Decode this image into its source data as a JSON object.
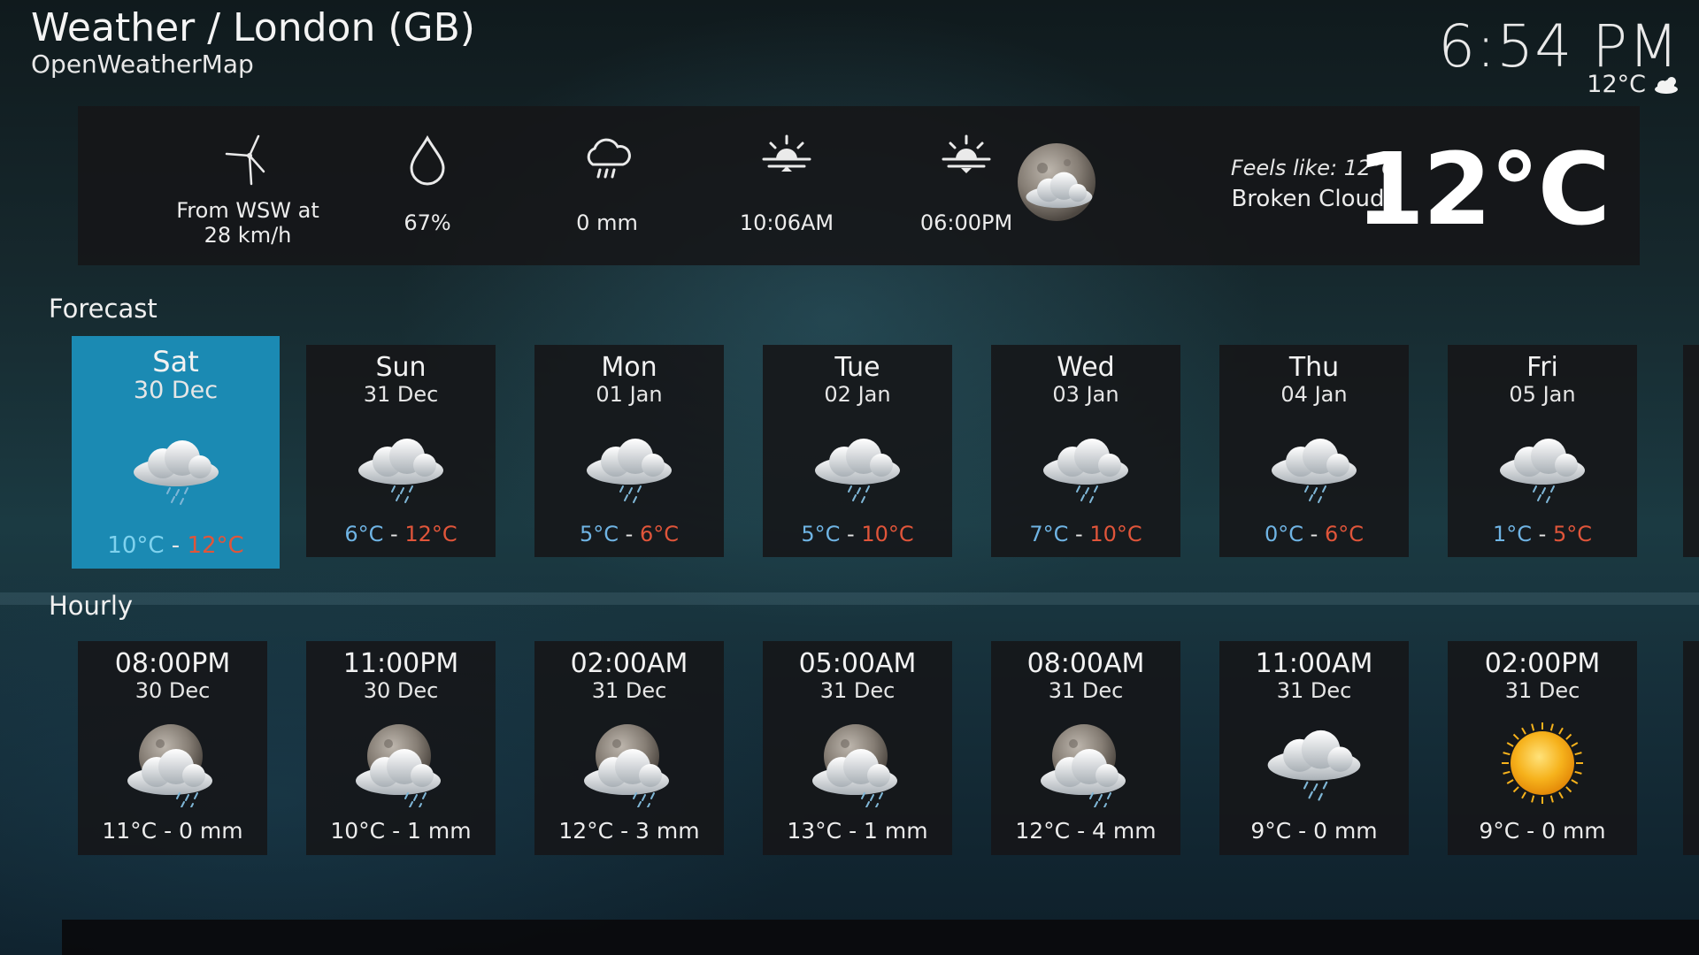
{
  "header": {
    "title": "Weather / London (GB)",
    "provider": "OpenWeatherMap",
    "clock": "6:54 PM",
    "clock_temp": "12°C",
    "clock_icon": "cloud-icon"
  },
  "current": {
    "wind": "From WSW at\n28 km/h",
    "wind_icon": "wind-turbine-icon",
    "humidity": "67%",
    "humidity_icon": "droplet-icon",
    "precipitation": "0 mm",
    "precipitation_icon": "rain-cloud-icon",
    "sunrise": "10:06AM",
    "sunrise_icon": "sunrise-icon",
    "sunset": "06:00PM",
    "sunset_icon": "sunset-icon",
    "condition_icon": "moon-cloud-icon",
    "feels_like": "Feels like: 12°C",
    "condition": "Broken Clouds",
    "temperature": "12°C"
  },
  "sections": {
    "forecast": "Forecast",
    "hourly": "Hourly"
  },
  "forecast": [
    {
      "day": "Sat",
      "date": "30 Dec",
      "low": "10°C",
      "sep": " - ",
      "high": "12°C",
      "icon": "rain-cloud-icon"
    },
    {
      "day": "Sun",
      "date": "31 Dec",
      "low": "6°C",
      "sep": " - ",
      "high": "12°C",
      "icon": "rain-cloud-icon"
    },
    {
      "day": "Mon",
      "date": "01 Jan",
      "low": "5°C",
      "sep": " - ",
      "high": "6°C",
      "icon": "rain-cloud-icon"
    },
    {
      "day": "Tue",
      "date": "02 Jan",
      "low": "5°C",
      "sep": " - ",
      "high": "10°C",
      "icon": "rain-cloud-icon"
    },
    {
      "day": "Wed",
      "date": "03 Jan",
      "low": "7°C",
      "sep": " - ",
      "high": "10°C",
      "icon": "rain-cloud-icon"
    },
    {
      "day": "Thu",
      "date": "04 Jan",
      "low": "0°C",
      "sep": " - ",
      "high": "6°C",
      "icon": "rain-cloud-icon"
    },
    {
      "day": "Fri",
      "date": "05 Jan",
      "low": "1°C",
      "sep": " - ",
      "high": "5°C",
      "icon": "rain-cloud-icon"
    }
  ],
  "hourly": [
    {
      "time": "08:00PM",
      "date": "30 Dec",
      "value": "11°C - 0 mm",
      "icon": "moon-rain-icon"
    },
    {
      "time": "11:00PM",
      "date": "30 Dec",
      "value": "10°C - 1 mm",
      "icon": "moon-rain-icon"
    },
    {
      "time": "02:00AM",
      "date": "31 Dec",
      "value": "12°C - 3 mm",
      "icon": "moon-rain-icon"
    },
    {
      "time": "05:00AM",
      "date": "31 Dec",
      "value": "13°C - 1 mm",
      "icon": "moon-rain-icon"
    },
    {
      "time": "08:00AM",
      "date": "31 Dec",
      "value": "12°C - 4 mm",
      "icon": "moon-rain-icon"
    },
    {
      "time": "11:00AM",
      "date": "31 Dec",
      "value": "9°C - 0 mm",
      "icon": "rain-cloud-icon"
    },
    {
      "time": "02:00PM",
      "date": "31 Dec",
      "value": "9°C - 0 mm",
      "icon": "sun-icon"
    }
  ],
  "colors": {
    "selected": "#1b8ab3",
    "low_temp": "#6fb4e4",
    "high_temp": "#e0553a"
  }
}
